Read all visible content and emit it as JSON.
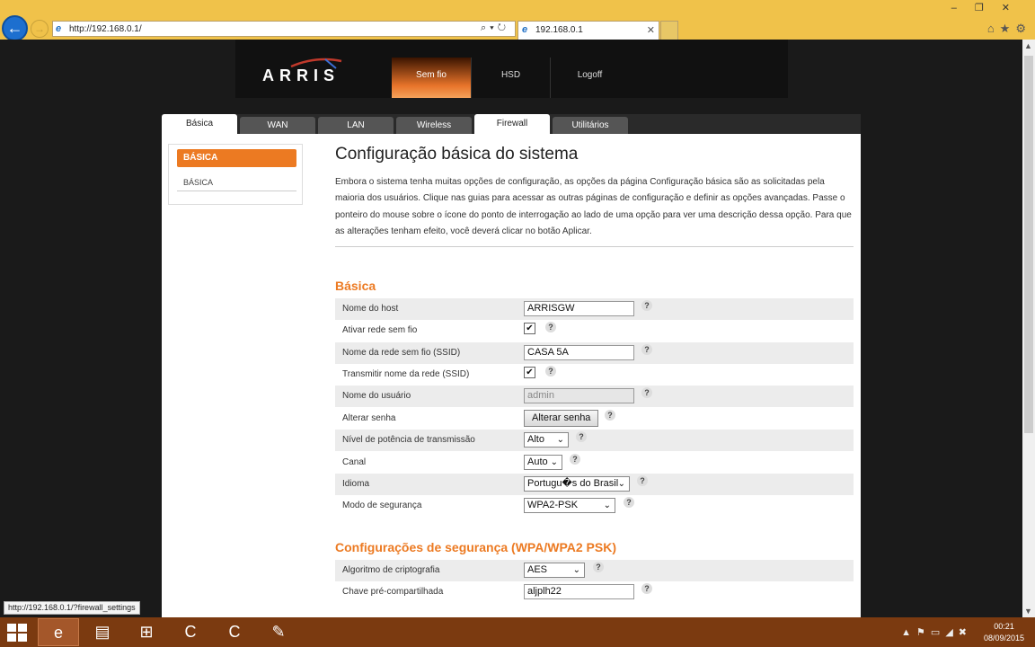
{
  "browser": {
    "url": "http://192.168.0.1/",
    "tab_title": "192.168.0.1",
    "status_url": "http://192.168.0.1/?firewall_settings"
  },
  "header": {
    "logo": "ARRIS",
    "nav": [
      "Sem fio",
      "HSD",
      "Logoff"
    ],
    "active_nav": "Sem fio"
  },
  "tabs": [
    "Básica",
    "WAN",
    "LAN",
    "Wireless",
    "Firewall",
    "Utilitários"
  ],
  "active_tab": "Básica",
  "sidebar": {
    "heading": "BÁSICA",
    "items": [
      "BÁSICA"
    ]
  },
  "main": {
    "title": "Configuração básica do sistema",
    "intro": "Embora o sistema tenha muitas opções de configuração, as opções da página Configuração básica são as solicitadas pela maioria dos usuários. Clique nas guias para acessar as outras páginas de configuração e definir as opções avançadas. Passe o ponteiro do mouse sobre o ícone do ponto de interrogação ao lado de uma opção para ver uma descrição dessa opção. Para que as alterações tenham efeito, você deverá clicar no botão Aplicar.",
    "section_basic": "Básica",
    "section_security": "Configurações de segurança (WPA/WPA2 PSK)",
    "help_glyph": "?",
    "check_glyph": "✔",
    "fields": {
      "hostname": {
        "label": "Nome do host",
        "value": "ARRISGW"
      },
      "wifi_enable": {
        "label": "Ativar rede sem fio",
        "checked": true
      },
      "ssid": {
        "label": "Nome da rede sem fio (SSID)",
        "value": "CASA 5A"
      },
      "broadcast_ssid": {
        "label": "Transmitir nome da rede (SSID)",
        "checked": true
      },
      "username": {
        "label": "Nome do usuário",
        "value": "admin"
      },
      "password": {
        "label": "Alterar senha",
        "button": "Alterar senha"
      },
      "tx_power": {
        "label": "Nível de potência de transmissão",
        "value": "Alto"
      },
      "channel": {
        "label": "Canal",
        "value": "Auto"
      },
      "language": {
        "label": "Idioma",
        "value": "Portugu�s do Brasil"
      },
      "security_mode": {
        "label": "Modo de segurança",
        "value": "WPA2-PSK"
      },
      "encryption": {
        "label": "Algoritmo de criptografia",
        "value": "AES"
      },
      "psk": {
        "label": "Chave pré-compartilhada",
        "value": "aljplh22"
      }
    }
  },
  "taskbar": {
    "time": "00:21",
    "date": "08/09/2015"
  },
  "colors": {
    "accent": "#ec7a22",
    "chrome": "#f0c24a",
    "taskbar": "#7b3a10"
  }
}
